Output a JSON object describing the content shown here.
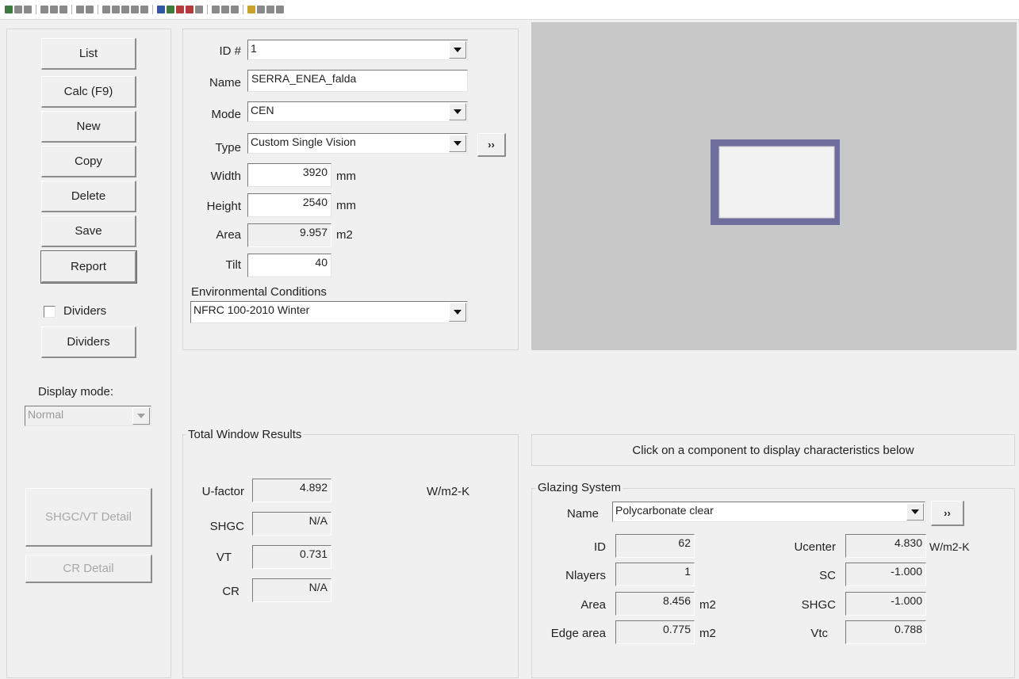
{
  "sidebar": {
    "list": "List",
    "calc": "Calc (F9)",
    "new": "New",
    "copy": "Copy",
    "delete": "Delete",
    "save": "Save",
    "report": "Report",
    "dividers_checkbox": "Dividers",
    "dividers_checked": false,
    "dividers_button": "Dividers",
    "display_mode_label": "Display mode:",
    "display_mode_value": "Normal",
    "shgc_vt_detail": "SHGC/VT Detail",
    "cr_detail": "CR Detail"
  },
  "window_form": {
    "id_label": "ID #",
    "id_value": "1",
    "name_label": "Name",
    "name_value": "SERRA_ENEA_falda",
    "mode_label": "Mode",
    "mode_value": "CEN",
    "type_label": "Type",
    "type_value": "Custom Single Vision",
    "type_more": "››",
    "width_label": "Width",
    "width_value": "3920",
    "width_unit": "mm",
    "height_label": "Height",
    "height_value": "2540",
    "height_unit": "mm",
    "area_label": "Area",
    "area_value": "9.957",
    "area_unit": "m2",
    "tilt_label": "Tilt",
    "tilt_value": "40",
    "env_label": "Environmental Conditions",
    "env_value": "NFRC 100-2010 Winter"
  },
  "results": {
    "title": "Total Window Results",
    "ufactor_label": "U-factor",
    "ufactor_value": "4.892",
    "ufactor_unit": "W/m2-K",
    "shgc_label": "SHGC",
    "shgc_value": "N/A",
    "vt_label": "VT",
    "vt_value": "0.731",
    "cr_label": "CR",
    "cr_value": "N/A"
  },
  "hint": "Click on a component to display characteristics below",
  "glazing": {
    "title": "Glazing System",
    "name_label": "Name",
    "name_value": "Polycarbonate clear",
    "more": "››",
    "id_label": "ID",
    "id_value": "62",
    "nlayers_label": "Nlayers",
    "nlayers_value": "1",
    "area_label": "Area",
    "area_value": "8.456",
    "area_unit": "m2",
    "edge_label": "Edge area",
    "edge_value": "0.775",
    "edge_unit": "m2",
    "ucenter_label": "Ucenter",
    "ucenter_value": "4.830",
    "ucenter_unit": "W/m2-K",
    "sc_label": "SC",
    "sc_value": "-1.000",
    "shgc_label": "SHGC",
    "shgc_value": "-1.000",
    "vtc_label": "Vtc",
    "vtc_value": "0.788"
  },
  "colors": {
    "background": "#f0f0f0",
    "preview_background": "#c8c8c8",
    "frame": "#6f6d9c",
    "glass": "#f2f2f2"
  }
}
